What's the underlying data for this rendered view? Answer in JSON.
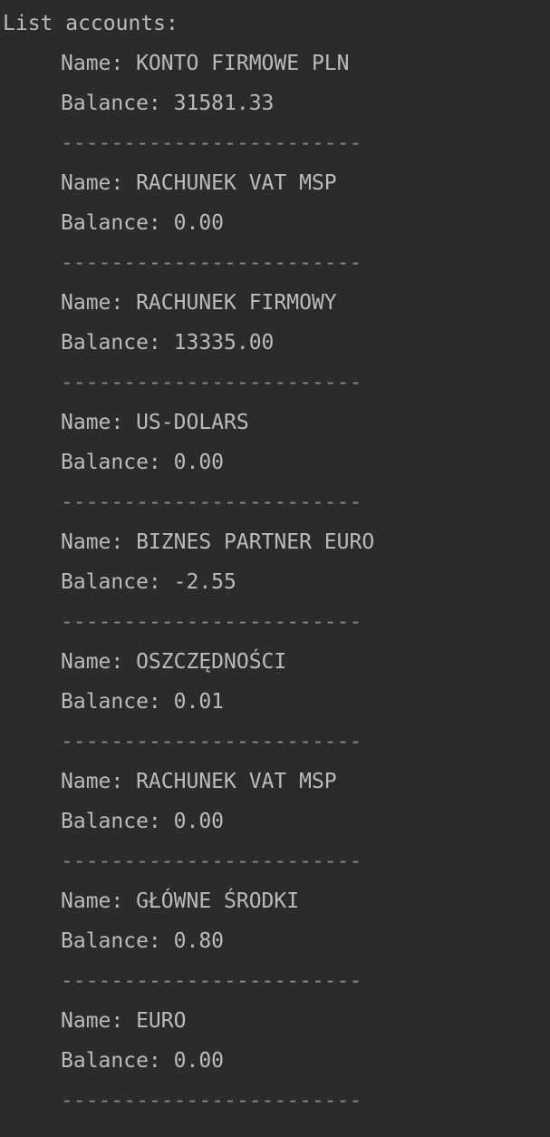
{
  "console": {
    "header": "List accounts:",
    "separator": "------------------------",
    "accounts": [
      {
        "name_line": "Name: KONTO FIRMOWE PLN",
        "balance_line": "Balance: 31581.33"
      },
      {
        "name_line": "Name: RACHUNEK VAT MSP",
        "balance_line": "Balance: 0.00"
      },
      {
        "name_line": "Name: RACHUNEK FIRMOWY",
        "balance_line": "Balance: 13335.00"
      },
      {
        "name_line": "Name: US-DOLARS",
        "balance_line": "Balance: 0.00"
      },
      {
        "name_line": "Name: BIZNES PARTNER EURO",
        "balance_line": "Balance: -2.55"
      },
      {
        "name_line": "Name: OSZCZĘDNOŚCI",
        "balance_line": "Balance: 0.01"
      },
      {
        "name_line": "Name: RACHUNEK VAT MSP",
        "balance_line": "Balance: 0.00"
      },
      {
        "name_line": "Name: GŁÓWNE ŚRODKI",
        "balance_line": "Balance: 0.80"
      },
      {
        "name_line": "Name: EURO",
        "balance_line": "Balance: 0.00"
      }
    ]
  },
  "colors": {
    "background": "#2b2b2b",
    "text": "#bbbbbb",
    "separator": "#8a8a8a"
  }
}
